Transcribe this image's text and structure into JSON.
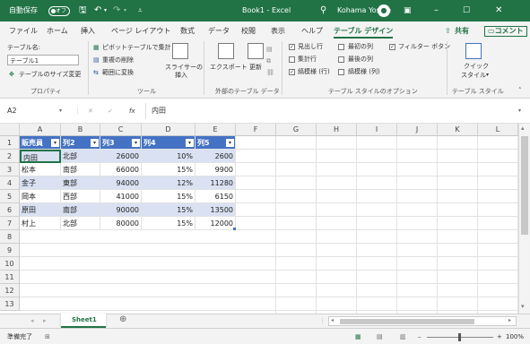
{
  "titlebar": {
    "autosave_label": "自動保存",
    "autosave_state": "オフ",
    "save_icon": "save-icon",
    "undo_icon": "undo-icon",
    "redo_icon": "redo-icon",
    "customize_icon": "customize-icon",
    "doc_title": "Book1 - Excel",
    "search_icon": "search-icon",
    "user_name": "Kohama Yoshie",
    "accent": "#217346"
  },
  "ribbon_tabs": [
    "ファイル",
    "ホーム",
    "挿入",
    "ページ レイアウト",
    "数式",
    "データ",
    "校閲",
    "表示",
    "ヘルプ",
    "テーブル デザイン"
  ],
  "ribbon_right": {
    "share": "共有",
    "comment": "コメント"
  },
  "ribbon": {
    "table_name_label": "テーブル名:",
    "table_name_value": "テーブル1",
    "resize_table": "テーブルのサイズ変更",
    "group_properties": "プロパティ",
    "pivot_summary": "ピボットテーブルで集計",
    "remove_duplicates": "重複の削除",
    "convert_to_range": "範囲に変換",
    "slicer_line1": "スライサーの",
    "slicer_line2": "挿入",
    "group_tools": "ツール",
    "export": "エクスポート",
    "refresh": "更新",
    "group_external": "外部のテーブル データ",
    "header_row": "見出し行",
    "total_row": "集計行",
    "banded_rows": "縞模様 (行)",
    "first_column": "最初の列",
    "last_column": "最後の列",
    "banded_columns": "縞模様 (列)",
    "filter_button": "フィルター ボタン",
    "group_style_options": "テーブル スタイルのオプション",
    "quick_styles_line1": "クイック",
    "quick_styles_line2": "スタイル",
    "group_styles": "テーブル スタイル",
    "checks": {
      "header_row": true,
      "total_row": false,
      "banded_rows": true,
      "first_column": false,
      "last_column": false,
      "banded_columns": false,
      "filter_button": true
    }
  },
  "formula_bar": {
    "name_box": "A2",
    "fx_label": "fx",
    "content": "内田"
  },
  "columns": [
    "A",
    "B",
    "C",
    "D",
    "E",
    "F",
    "G",
    "H",
    "I",
    "J",
    "K",
    "L"
  ],
  "row_numbers": [
    "1",
    "2",
    "3",
    "4",
    "5",
    "6",
    "7",
    "8",
    "9",
    "10",
    "11",
    "12",
    "13"
  ],
  "table": {
    "headers": [
      "販売員",
      "列2",
      "列3",
      "列4",
      "列5"
    ],
    "rows": [
      [
        "内田",
        "北部",
        "26000",
        "10%",
        "2600"
      ],
      [
        "松本",
        "南部",
        "66000",
        "15%",
        "9900"
      ],
      [
        "金子",
        "東部",
        "94000",
        "12%",
        "11280"
      ],
      [
        "岡本",
        "西部",
        "41000",
        "15%",
        "6150"
      ],
      [
        "原田",
        "南部",
        "90000",
        "15%",
        "13500"
      ],
      [
        "村上",
        "北部",
        "80000",
        "15%",
        "12000"
      ]
    ],
    "header_color": "#4472c4",
    "band_color": "#d9e1f2"
  },
  "sheet_tabs": [
    "Sheet1"
  ],
  "status": {
    "ready": "準備完了",
    "zoom": "100%"
  }
}
